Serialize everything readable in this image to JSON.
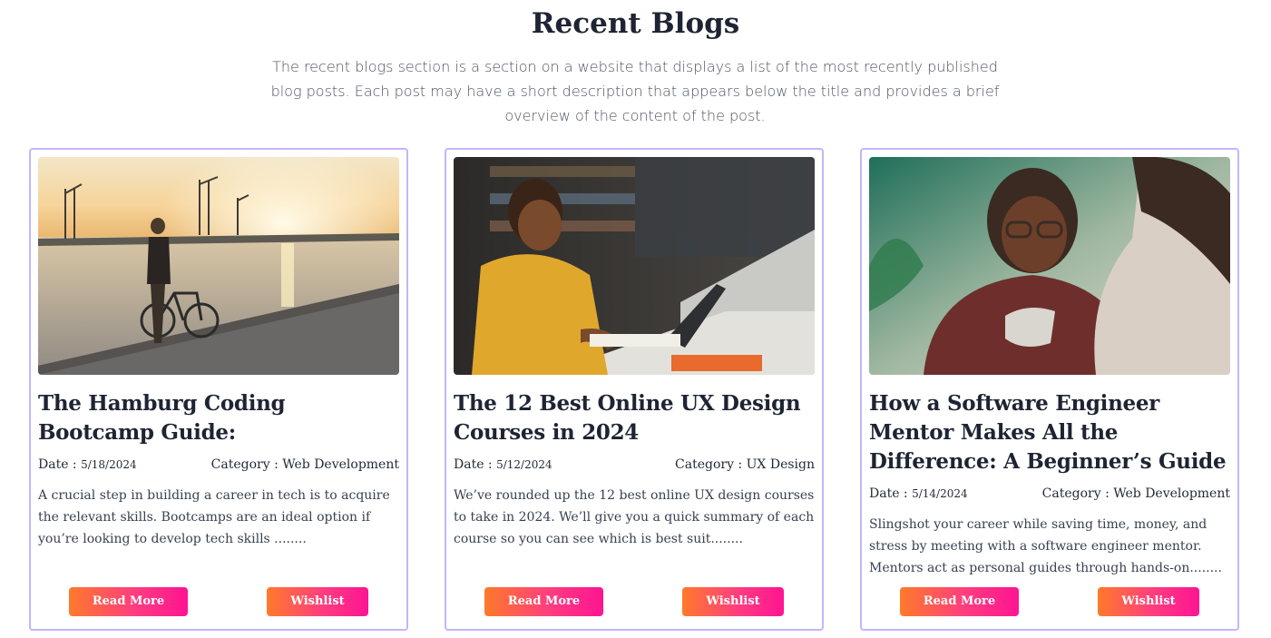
{
  "section": {
    "title": "Recent Blogs",
    "description": "The recent blogs section is a section on a website that displays a list of the most recently published blog posts. Each post may have a short description that appears below the title and provides a brief overview of the content of the post."
  },
  "labels": {
    "date": "Date : ",
    "category": "Category : "
  },
  "posts": [
    {
      "title": "The Hamburg Coding Bootcamp Guide:",
      "date": "5/18/2024",
      "category": "Web Development",
      "description": "A crucial step in building a career in tech is to acquire the relevant skills. Bootcamps are an ideal option if you’re looking to develop tech skills ........",
      "read_more": "Read More",
      "wishlist": "Wishlist"
    },
    {
      "title": "The 12 Best Online UX Design Courses in 2024",
      "date": "5/12/2024",
      "category": "UX Design",
      "description": "We’ve rounded up the 12 best online UX design courses to take in 2024. We’ll give you a quick summary of each course so you can see which is best suit........",
      "read_more": "Read More",
      "wishlist": "Wishlist"
    },
    {
      "title": "How a Software Engineer Mentor Makes All the Difference: A Beginner’s Guide",
      "date": "5/14/2024",
      "category": "Web Development",
      "description": "Slingshot your career while saving time, money, and stress by meeting with a software engineer mentor. Mentors act as personal guides through hands-on........",
      "read_more": "Read More",
      "wishlist": "Wishlist"
    }
  ],
  "colors": {
    "card_border": "#c4b5fd",
    "button_gradient_start": "#ff7a2a",
    "button_gradient_end": "#ff1493"
  }
}
